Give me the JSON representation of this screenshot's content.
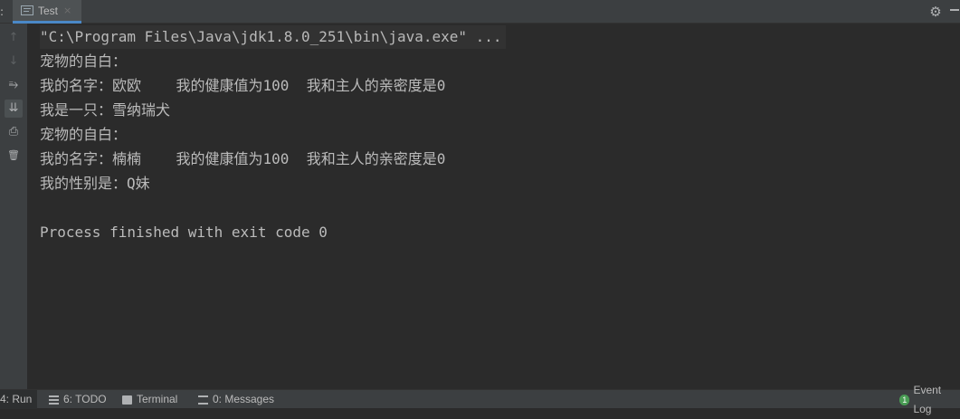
{
  "tab": {
    "label": "Test",
    "close": "×"
  },
  "toolbar": {
    "gear": "⚙"
  },
  "gutter": {
    "up": "↑",
    "down": "↓",
    "wrap": "⥱",
    "scroll": "⇊",
    "print": "⎙",
    "trash": "🗑"
  },
  "console": {
    "lines": [
      "\"C:\\Program Files\\Java\\jdk1.8.0_251\\bin\\java.exe\" ...",
      "宠物的自白：",
      "我的名字：欧欧    我的健康值为100  我和主人的亲密度是0",
      "我是一只：雪纳瑞犬",
      "宠物的自白：",
      "我的名字：楠楠    我的健康值为100  我和主人的亲密度是0",
      "我的性别是：Q妹",
      "",
      "Process finished with exit code 0"
    ]
  },
  "statusbar": {
    "run": "4: Run",
    "todo": "6: TODO",
    "terminal": "Terminal",
    "messages": "0: Messages",
    "event_log": "Event Log",
    "event_count": "1"
  },
  "colors": {
    "accent": "#4a88c7",
    "background": "#2b2b2b",
    "panel": "#3c3f41"
  }
}
